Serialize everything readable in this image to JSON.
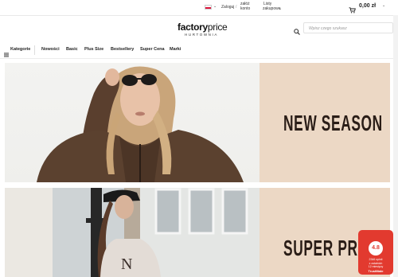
{
  "topbar": {
    "login": "Zaloguj",
    "separator": "/",
    "register_line1": "załóż",
    "register_line2": "konto",
    "lists_line1": "Listy",
    "lists_line2": "zakupowe",
    "cart_amount": "0,00 zł"
  },
  "logo": {
    "word_bold": "factory",
    "word_light": "price",
    "sub": "HURTOWNIA"
  },
  "search": {
    "placeholder": "Wpisz czego szukasz"
  },
  "nav": {
    "categories": "Kategorie",
    "items": [
      "Nowości",
      "Basic",
      "Plus Size",
      "Bestsellery",
      "Super Cena",
      "Marki"
    ]
  },
  "banners": [
    {
      "headline": "NEW SEASON"
    },
    {
      "headline": "SUPER PRICE"
    }
  ],
  "trust_badge": {
    "rating": "4.8",
    "line1": "2346 opinii",
    "line2": "z ostatnich",
    "line3": "12 miesięcy",
    "brand": "TrustMate"
  },
  "colors": {
    "banner_panel": "#ecd8c5",
    "headline": "#2a1d17",
    "badge": "#e23a2f"
  }
}
